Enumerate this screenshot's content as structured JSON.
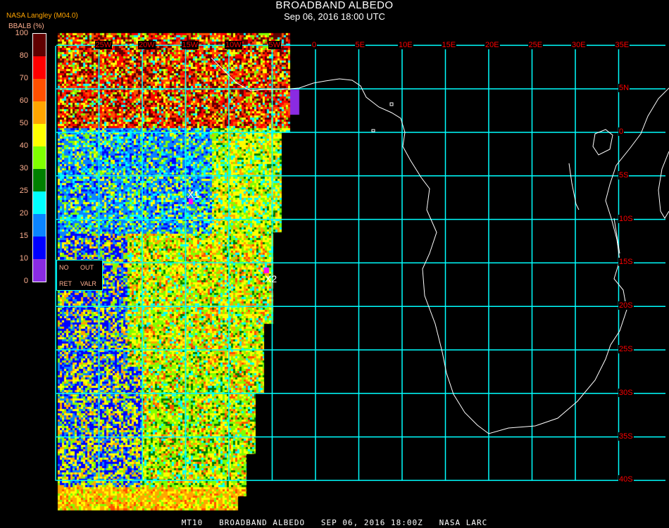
{
  "header": {
    "title": "BROADBAND ALBEDO",
    "subtitle": "Sep 06, 2016 18:00 UTC"
  },
  "source": "NASA Langley (M04.0)",
  "legend": {
    "units": "BBALB (%)",
    "labels": [
      "0",
      "10",
      "15",
      "20",
      "25",
      "30",
      "40",
      "50",
      "60",
      "70",
      "80",
      "100"
    ],
    "colors": [
      "#8a2be2",
      "#0000ff",
      "#0a84ff",
      "#00ffff",
      "#008000",
      "#80ff00",
      "#ffff00",
      "#ffa500",
      "#ff5000",
      "#ff0000",
      "#600000"
    ]
  },
  "no_retrieval_box": {
    "line1_left": "NO",
    "line1_right": "OUT",
    "line2_left": "RET",
    "line2_right": "VALR"
  },
  "markers": [
    "X1",
    "X2"
  ],
  "grid": {
    "lon_labels": [
      "25W",
      "20W",
      "15W",
      "10W",
      "5W",
      "0",
      "5E",
      "10E",
      "15E",
      "20E",
      "25E",
      "30E",
      "35E"
    ],
    "lat_labels": [
      "5N",
      "0",
      "5S",
      "10S",
      "15S",
      "20S",
      "25S",
      "30S",
      "35S",
      "40S"
    ],
    "grid_color": "#00ffff",
    "label_color": "#ff0000"
  },
  "footer": "MT10   BROADBAND ALBEDO   SEP 06, 2016 18:00Z   NASA LARC"
}
